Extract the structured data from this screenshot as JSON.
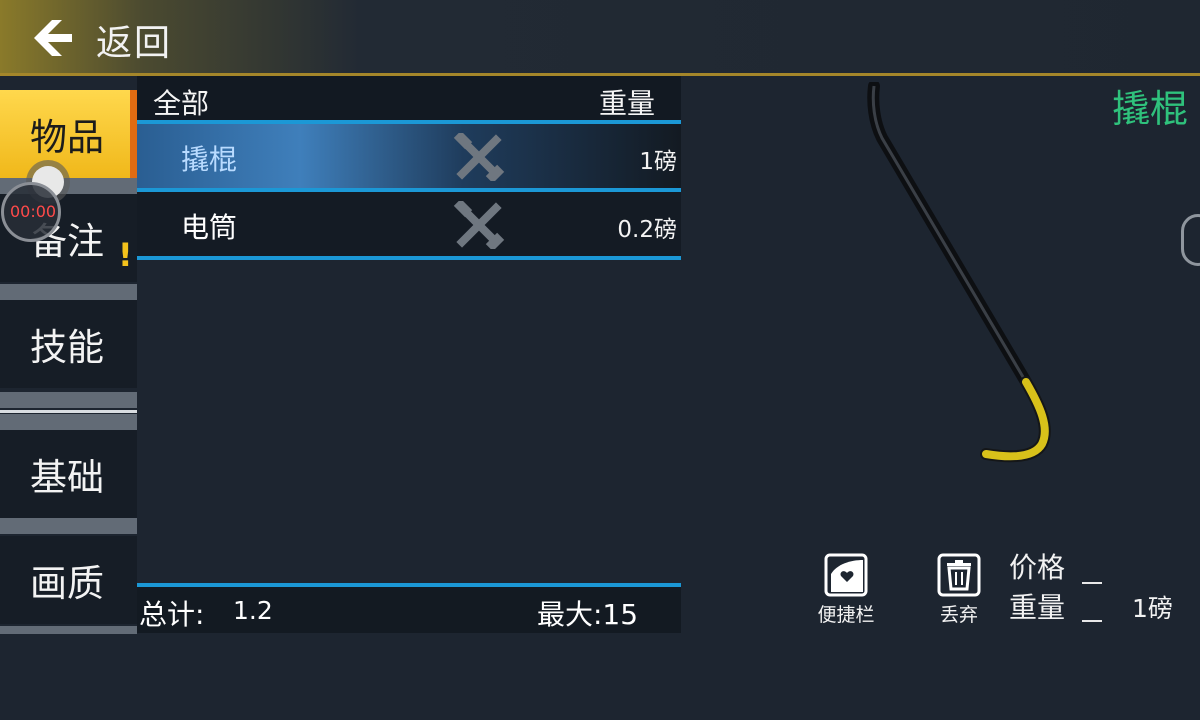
{
  "header": {
    "back_label": "返回"
  },
  "nav": {
    "items": [
      {
        "label": "物品"
      },
      {
        "label": "备注"
      },
      {
        "label": "技能"
      },
      {
        "label": "基础"
      },
      {
        "label": "画质"
      }
    ],
    "skills_alert": "!"
  },
  "recorder": {
    "time": "00:00"
  },
  "list": {
    "header_all": "全部",
    "header_weight": "重量",
    "rows": [
      {
        "name": "撬棍",
        "weight": "1磅",
        "icon": "tools-icon"
      },
      {
        "name": "电筒",
        "weight": "0.2磅",
        "icon": "tools-icon"
      }
    ]
  },
  "totals": {
    "total_label": "总计:",
    "total_value": "1.2",
    "max_label": "最大:15"
  },
  "detail": {
    "title": "撬棍",
    "shortcut_label": "便捷栏",
    "discard_label": "丢弃",
    "price_label": "价格",
    "weight_label": "重量",
    "weight_value": "1磅"
  },
  "colors": {
    "accent_blue": "#1b98d6",
    "active_nav": "#f0b81a",
    "title_green": "#2fc27c"
  }
}
